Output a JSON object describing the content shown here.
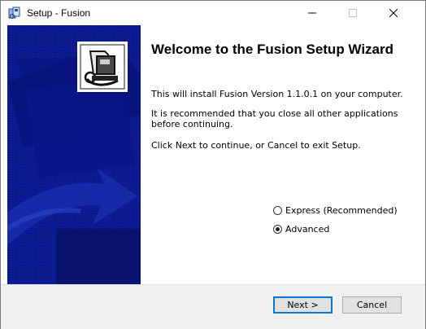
{
  "window": {
    "title": "Setup - Fusion",
    "minimize_label": "—",
    "maximize_label": "☐",
    "close_label": "✕"
  },
  "welcome": {
    "heading": "Welcome to the Fusion Setup Wizard",
    "paragraph1": "This will install Fusion Version 1.1.0.1 on your computer.",
    "paragraph2": "It is recommended that you close all other applications before continuing.",
    "paragraph3": "Click Next to continue, or Cancel to exit Setup."
  },
  "options": {
    "express_label": "Express (Recommended)",
    "express_checked": false,
    "advanced_label": "Advanced",
    "advanced_checked": true
  },
  "buttons": {
    "next": "Next >",
    "cancel": "Cancel"
  },
  "colors": {
    "side_panel": "#0b1a8c",
    "side_panel_dark": "#06105e",
    "accent": "#0078d7"
  }
}
